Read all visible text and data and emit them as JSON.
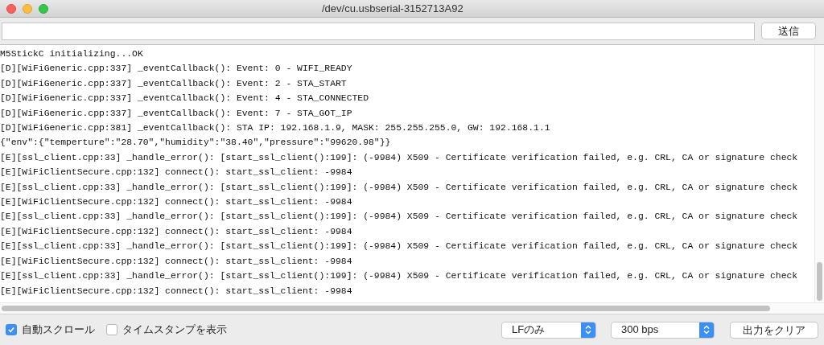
{
  "window": {
    "title": "/dev/cu.usbserial-3152713A92"
  },
  "send_button": "送信",
  "log_lines": [
    "M5StickC initializing...OK",
    "[D][WiFiGeneric.cpp:337] _eventCallback(): Event: 0 - WIFI_READY",
    "[D][WiFiGeneric.cpp:337] _eventCallback(): Event: 2 - STA_START",
    "[D][WiFiGeneric.cpp:337] _eventCallback(): Event: 4 - STA_CONNECTED",
    "[D][WiFiGeneric.cpp:337] _eventCallback(): Event: 7 - STA_GOT_IP",
    "[D][WiFiGeneric.cpp:381] _eventCallback(): STA IP: 192.168.1.9, MASK: 255.255.255.0, GW: 192.168.1.1",
    "{\"env\":{\"temperture\":\"28.70\",\"humidity\":\"38.40\",\"pressure\":\"99620.98\"}}",
    "[E][ssl_client.cpp:33] _handle_error(): [start_ssl_client():199]: (-9984) X509 - Certificate verification failed, e.g. CRL, CA or signature check",
    "[E][WiFiClientSecure.cpp:132] connect(): start_ssl_client: -9984",
    "[E][ssl_client.cpp:33] _handle_error(): [start_ssl_client():199]: (-9984) X509 - Certificate verification failed, e.g. CRL, CA or signature check",
    "[E][WiFiClientSecure.cpp:132] connect(): start_ssl_client: -9984",
    "[E][ssl_client.cpp:33] _handle_error(): [start_ssl_client():199]: (-9984) X509 - Certificate verification failed, e.g. CRL, CA or signature check",
    "[E][WiFiClientSecure.cpp:132] connect(): start_ssl_client: -9984",
    "[E][ssl_client.cpp:33] _handle_error(): [start_ssl_client():199]: (-9984) X509 - Certificate verification failed, e.g. CRL, CA or signature check",
    "[E][WiFiClientSecure.cpp:132] connect(): start_ssl_client: -9984",
    "[E][ssl_client.cpp:33] _handle_error(): [start_ssl_client():199]: (-9984) X509 - Certificate verification failed, e.g. CRL, CA or signature check",
    "[E][WiFiClientSecure.cpp:132] connect(): start_ssl_client: -9984"
  ],
  "options": [
    {
      "label": "自動スクロール",
      "checked": true
    },
    {
      "label": "タイムスタンプを表示",
      "checked": false
    }
  ],
  "line_ending_select": "LFのみ",
  "baud_select": "300 bps",
  "clear_button": "出力をクリア"
}
